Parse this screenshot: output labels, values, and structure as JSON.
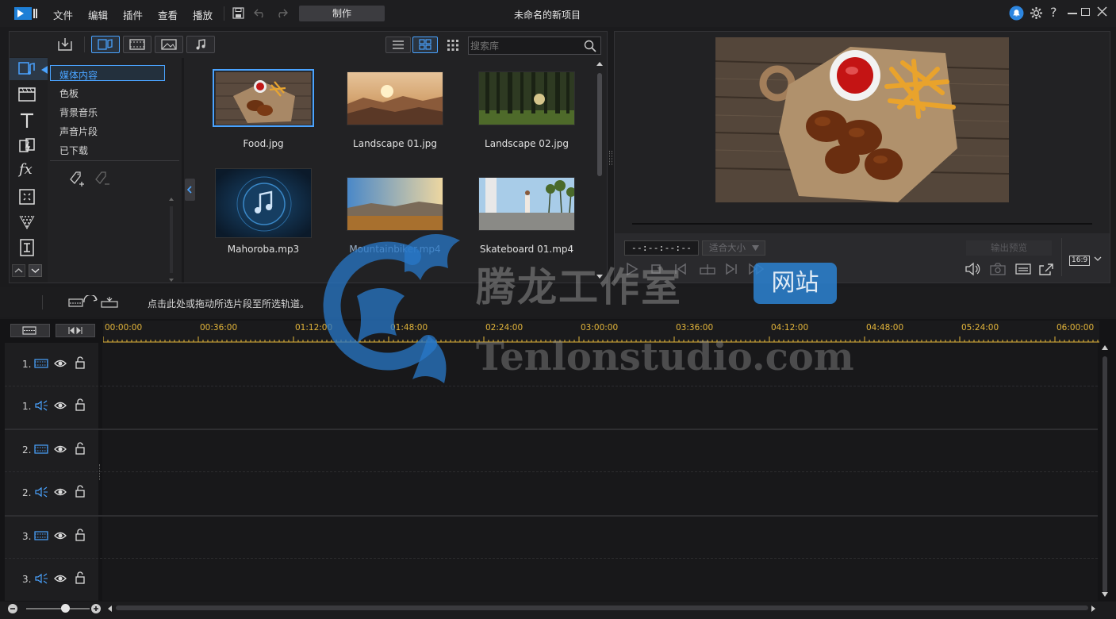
{
  "app": {
    "title": "未命名的新项目",
    "menu": [
      "文件",
      "编辑",
      "插件",
      "查看",
      "播放"
    ],
    "produce_label": "制作",
    "help_label": "?"
  },
  "library": {
    "search_placeholder": "搜索库",
    "categories": [
      "媒体内容",
      "色板",
      "背景音乐",
      "声音片段",
      "已下载"
    ],
    "items": [
      {
        "name": "Food.jpg",
        "type": "image",
        "selected": true
      },
      {
        "name": "Landscape 01.jpg",
        "type": "image"
      },
      {
        "name": "Landscape 02.jpg",
        "type": "image"
      },
      {
        "name": "Mahoroba.mp3",
        "type": "audio"
      },
      {
        "name": "Mountainbiker.mp4",
        "type": "video"
      },
      {
        "name": "Skateboard 01.mp4",
        "type": "video"
      }
    ]
  },
  "preview": {
    "timecode": "--:--:--:--",
    "fit_label": "适合大小",
    "output_label": "输出预览",
    "aspect_label": "16:9"
  },
  "timeline": {
    "hint": "点击此处或拖动所选片段至所选轨道。",
    "ruler": [
      "00:00:00",
      "00:36:00",
      "01:12:00",
      "01:48:00",
      "02:24:00",
      "03:00:00",
      "03:36:00",
      "04:12:00",
      "04:48:00",
      "05:24:00",
      "06:00:00"
    ],
    "tracks": [
      {
        "label": "1.",
        "kind": "video"
      },
      {
        "label": "1.",
        "kind": "audio"
      },
      {
        "label": "2.",
        "kind": "video"
      },
      {
        "label": "2.",
        "kind": "audio"
      },
      {
        "label": "3.",
        "kind": "video"
      },
      {
        "label": "3.",
        "kind": "audio"
      }
    ]
  },
  "watermark": {
    "cn": "腾龙工作室",
    "badge": "网站",
    "en": "Tenlonstudio.com"
  },
  "colors": {
    "accent": "#4aa3ff",
    "ruler": "#e3b53a",
    "bg": "#1b1b1d"
  }
}
